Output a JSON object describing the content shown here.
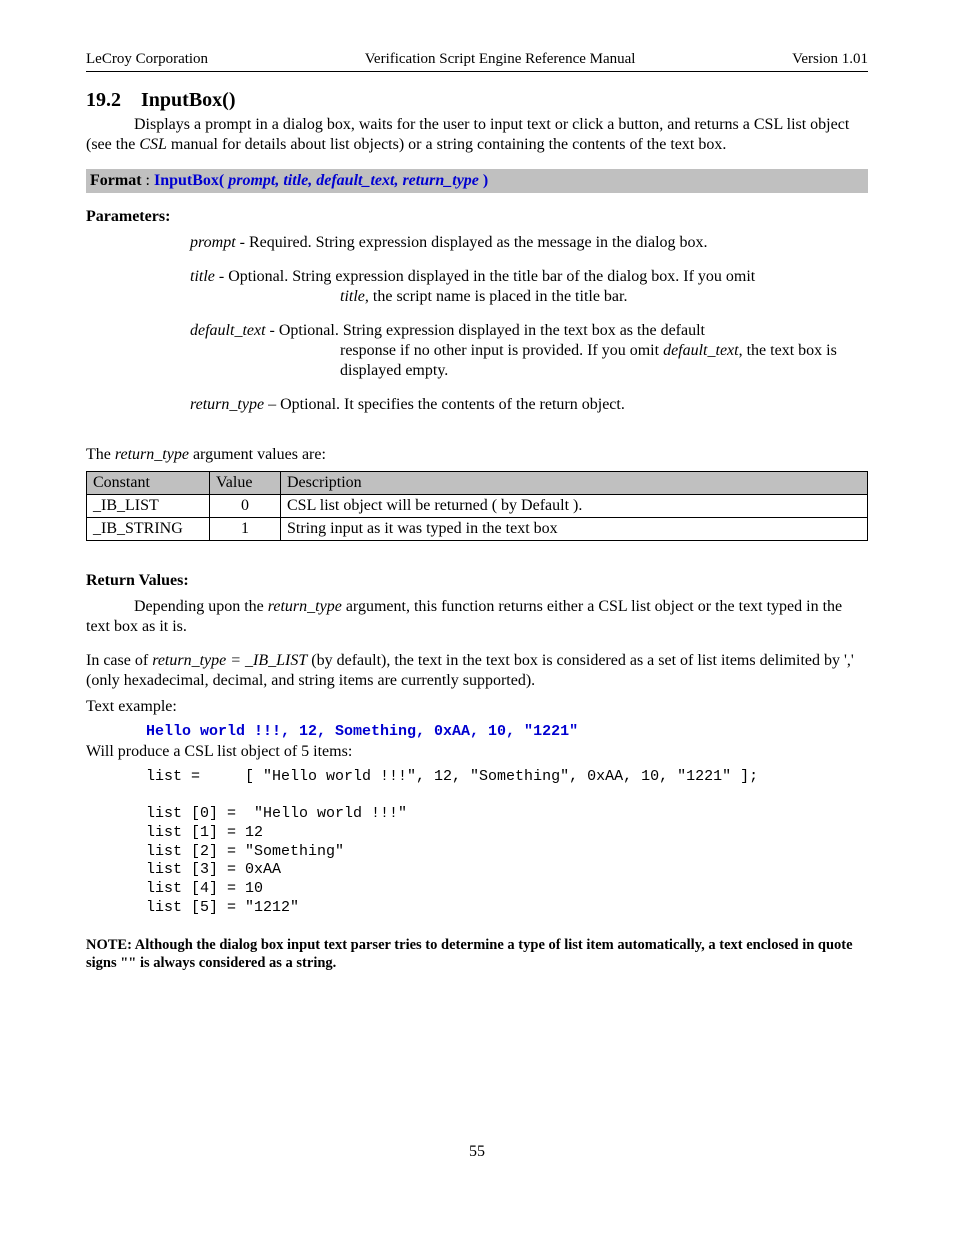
{
  "header": {
    "left": "LeCroy Corporation",
    "center": "Verification Script Engine Reference Manual",
    "right": "Version 1.01"
  },
  "section": {
    "number": "19.2",
    "title": "InputBox()"
  },
  "intro": {
    "p1a": "Displays a prompt in a dialog box, waits for the user to input text or click a button, and returns a CSL list object (see the ",
    "p1b": "CSL",
    "p1c": " manual for details about list objects) or a string containing the contents of the text box."
  },
  "format": {
    "label": "Format",
    "colon": " :    ",
    "fn_open": "InputBox( ",
    "args": "prompt, title, default_text, return_type",
    "fn_close": " )"
  },
  "params": {
    "heading": "Parameters:",
    "prompt": {
      "name": "prompt",
      "sep": " -  ",
      "desc": "Required. String expression displayed as the message in the dialog box."
    },
    "title": {
      "name": "title",
      "sep": " - ",
      "line1": "Optional. String expression displayed in the title bar of the dialog box. If you omit",
      "cont_name": "title",
      "cont_rest": ", the script name is placed in the title bar."
    },
    "default_text": {
      "name": "default_text",
      "sep": " - ",
      "line1": "Optional. String expression displayed in the text box as the default",
      "cont1a": " response if no other input is provided. If you omit ",
      "cont1b": "default_text",
      "cont1c": ", the text box is",
      "cont2": "displayed empty."
    },
    "return_type": {
      "name": "return_type",
      "sep": " – ",
      "desc": "Optional. It specifies the contents of the return object."
    }
  },
  "table": {
    "intro_a": "The ",
    "intro_b": "return_type",
    "intro_c": " argument values are:",
    "headers": {
      "c1": "Constant",
      "c2": "Value",
      "c3": "Description"
    },
    "rows": [
      {
        "c1": "_IB_LIST",
        "c2": "0",
        "c3": "CSL list object will be returned ( by Default )."
      },
      {
        "c1": "_IB_STRING",
        "c2": "1",
        "c3": "String input as it was typed in the text box"
      }
    ]
  },
  "retvals": {
    "heading": "Return Values:",
    "p1a": "Depending upon the ",
    "p1b": "return_type",
    "p1c": " argument, this function returns either a CSL list object or the text typed in the text box as it is.",
    "p2a": " In case of   ",
    "p2b": "return_type  =  _IB_LIST",
    "p2c": " (by default), the text in the text box is considered as a set of list items delimited by ',' (only hexadecimal, decimal, and string items are currently supported).",
    "p3": "Text example:",
    "example_code": "Hello world !!!, 12, Something, 0xAA, 10, \"1221\"",
    "p4": "Will produce a CSL list object of 5 items:",
    "code_lines": "list =     [ \"Hello world !!!\", 12, \"Something\", 0xAA, 10, \"1221\" ];\n\nlist [0] =  \"Hello world !!!\"\nlist [1] = 12\nlist [2] = \"Something\"\nlist [3] = 0xAA\nlist [4] = 10\nlist [5] = \"1212\""
  },
  "note": "NOTE: Although the dialog box input text parser tries to determine a type of list item automatically, a text enclosed in quote signs \"\" is always considered as a string.",
  "page_number": "55"
}
